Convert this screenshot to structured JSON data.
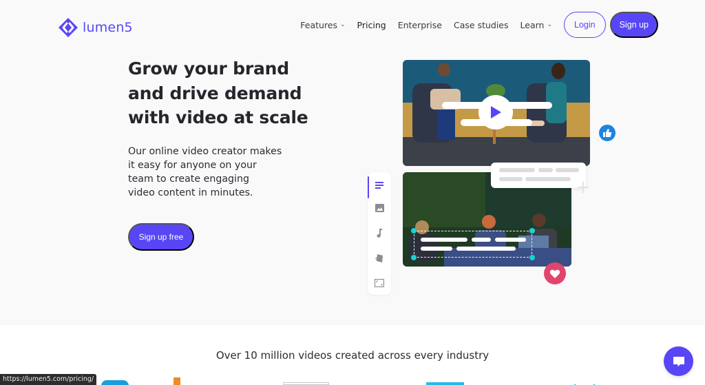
{
  "brand": {
    "name": "lumen5",
    "accent": "#5846f6"
  },
  "nav": {
    "items": [
      {
        "label": "Features",
        "has_dropdown": true
      },
      {
        "label": "Pricing",
        "has_dropdown": false
      },
      {
        "label": "Enterprise",
        "has_dropdown": false
      },
      {
        "label": "Case studies",
        "has_dropdown": false
      },
      {
        "label": "Learn",
        "has_dropdown": true
      }
    ],
    "chevron": "⌄",
    "login_label": "Login",
    "signup_label": "Sign up"
  },
  "hero": {
    "headline_lines": [
      "Grow your brand",
      "and drive demand",
      "with video at scale"
    ],
    "subcopy_lines": [
      "Our online video creator makes",
      "it easy for anyone on your",
      "team to create engaging",
      "video content in minutes."
    ],
    "cta_label": "Sign up free"
  },
  "illustration": {
    "toolbar_tools": [
      "text-icon",
      "image-icon",
      "music-icon",
      "style-icon",
      "resize-icon"
    ],
    "reactions": [
      "like-icon",
      "heart-icon"
    ]
  },
  "social_proof": {
    "heading": "Over 10 million videos created across every industry"
  },
  "status_bar": {
    "url": "https://lumen5.com/pricing/"
  },
  "colors": {
    "like": "#1b86e0",
    "heart": "#e2456c",
    "handle": "#17d2d8"
  }
}
